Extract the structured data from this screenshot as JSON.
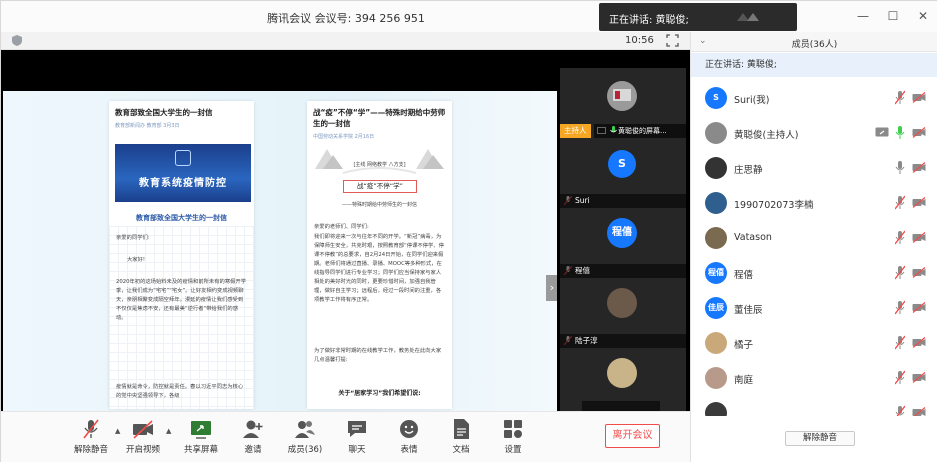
{
  "window": {
    "title": "腾讯会议 会议号: 394 256 951",
    "speaking_toast": "正在讲话: 黄聪俊;",
    "clock": "10:56"
  },
  "slide": {
    "doc1": {
      "title": "教育部致全国大学生的一封信",
      "meta": "教育部新闻办  教育部  3月3日",
      "banner_title": "教育系统疫情防控",
      "subheading": "教育部致全国大学生的一封信",
      "greeting": "亲爱的同学们:",
      "hello": "大家好!",
      "para1": "2020年初的这场始料未及的疫情和前所未有的寒假开学季，让我们成为“宅宅”“宅女”。让好友相约变成视频聊天，亲朋相聚变成隔空拜年。漫延的疫情让我们感受到不仅仅是焦虑不安，还有最美“逆行者”带给我们的感动。",
      "para2": "疫情就是命令，防控就是责任。春以习近平同志为核心的党中央坚强领导下，各级"
    },
    "doc2": {
      "title": "战“疫”不停“学”——特殊时期给中劳师生的一封信",
      "meta": "中国劳动关系学院  2月16日",
      "art_label": "[主线  网络教学  八方支]",
      "quote_box": "战“疫”不停“学”",
      "subline": "——特殊时期给中劳师生的一封信",
      "greeting": "亲爱的老师们、同学们:",
      "para1": "我们即将迎来一次与往年不同的开学。“新冠”病毒，为保障师生安全，共克时艰，按照教育部“停课不停学、停课不停教”的总要求，自2月24日开始，在同学们迎来假期。老师们将通过直播、录播、MOOC等多种形式，在线指导同学们进行专业学习；同学们应当保持家与家人相处的美好时光的同时，更要珍惜时间，加强自我管理，做好自主学习；远程后，经过一段时间的注重，各项教学工作将有序正常。",
      "para2": "为了做好非常时期的在线教学工作，教务处在此向大家几点温馨打提:",
      "bottom": "关于“居家学习”我们希望们说:"
    }
  },
  "videos": [
    {
      "label": "黄聪俊的屏幕...",
      "host_badge": "主持人"
    },
    {
      "label": "Suri",
      "avatar_text": "S",
      "avatar_color": "#1677ff"
    },
    {
      "label": "程僖",
      "avatar_text": "程僖",
      "avatar_color": "#1677ff"
    },
    {
      "label": "陆子淳"
    },
    {
      "label": ""
    }
  ],
  "toolbar": {
    "unmute": "解除静音",
    "video": "开启视频",
    "share": "共享屏幕",
    "invite": "邀请",
    "members": "成员(36)",
    "chat": "聊天",
    "reactions": "表情",
    "docs": "文档",
    "settings": "设置",
    "leave": "离开会议"
  },
  "panel": {
    "title": "成员(36人)",
    "speaking": "正在讲话: 黄聪俊;",
    "unmute_all": "解除静音",
    "members": [
      {
        "name": "Suri(我)",
        "avatar_text": "S",
        "avatar_color": "#1677ff",
        "mic": "muted",
        "cam": "off"
      },
      {
        "name": "黄聪俊(主持人)",
        "avatar_color": "#8a8a8a",
        "mic": "active",
        "cam": "off",
        "sharing": true
      },
      {
        "name": "庄思静",
        "avatar_color": "#333333",
        "mic": "on",
        "cam": "off"
      },
      {
        "name": "1990702073李楠",
        "avatar_color": "#2f5f8f",
        "mic": "muted",
        "cam": "off"
      },
      {
        "name": "Vatason",
        "avatar_color": "#7a6a4f",
        "mic": "muted",
        "cam": "off"
      },
      {
        "name": "程僖",
        "avatar_text": "程僖",
        "avatar_color": "#1677ff",
        "mic": "muted",
        "cam": "off"
      },
      {
        "name": "董佳辰",
        "avatar_text": "佳辰",
        "avatar_color": "#1677ff",
        "mic": "muted",
        "cam": "off"
      },
      {
        "name": "橘子",
        "avatar_color": "#c9a97a",
        "mic": "muted",
        "cam": "off"
      },
      {
        "name": "南庭",
        "avatar_color": "#b89a8a",
        "mic": "muted",
        "cam": "off"
      },
      {
        "name": "",
        "avatar_color": "#3a3a3a",
        "mic": "muted",
        "cam": "off"
      }
    ]
  },
  "colors": {
    "accent": "#1677ff",
    "danger": "#f24b4b",
    "host_badge": "#f5a623",
    "speaking_bg": "#e7f0fb"
  }
}
